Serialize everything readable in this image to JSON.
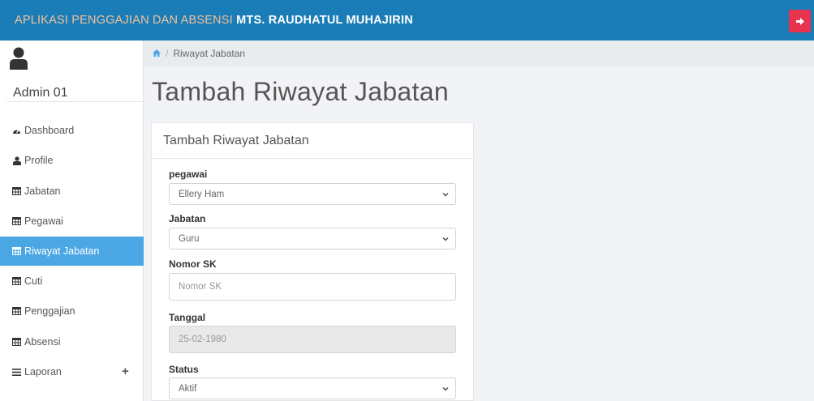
{
  "header": {
    "title_prefix": "APLIKASI PENGGAJIAN DAN ABSENSI ",
    "title_school": "MTS. RAUDHATUL MUHAJIRIN",
    "bg_color": "#1a7db8",
    "logout_icon": "sign-out-icon",
    "logout_color": "#e8334f"
  },
  "sidebar": {
    "username": "Admin 01",
    "items": [
      {
        "label": "Dashboard",
        "icon": "tachometer-icon"
      },
      {
        "label": "Profile",
        "icon": "user-icon"
      },
      {
        "label": "Jabatan",
        "icon": "table-icon"
      },
      {
        "label": "Pegawai",
        "icon": "table-icon"
      },
      {
        "label": "Riwayat Jabatan",
        "icon": "table-icon",
        "active": true
      },
      {
        "label": "Cuti",
        "icon": "table-icon"
      },
      {
        "label": "Penggajian",
        "icon": "table-icon"
      },
      {
        "label": "Absensi",
        "icon": "table-icon"
      },
      {
        "label": "Laporan",
        "icon": "bars-icon",
        "expand": "+"
      }
    ],
    "active_color": "#4aa7e3"
  },
  "breadcrumb": {
    "home_icon": "home-icon",
    "separator": "/",
    "current": "Riwayat Jabatan"
  },
  "page_title": "Tambah Riwayat Jabatan",
  "form": {
    "title": "Tambah Riwayat Jabatan",
    "fields": {
      "pegawai": {
        "label": "pegawai",
        "value": "Ellery Ham"
      },
      "jabatan": {
        "label": "Jabatan",
        "value": "Guru"
      },
      "nomor_sk": {
        "label": "Nomor SK",
        "placeholder": "Nomor SK",
        "value": ""
      },
      "tanggal": {
        "label": "Tanggal",
        "value": "25-02-1980"
      },
      "status": {
        "label": "Status",
        "value": "Aktif"
      }
    }
  }
}
